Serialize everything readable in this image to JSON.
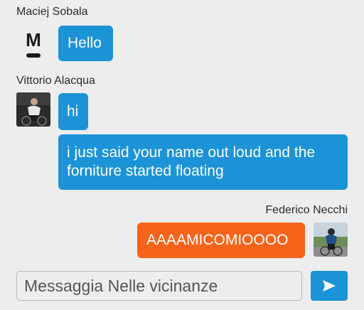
{
  "chat": {
    "messages": [
      {
        "sender": "Maciej Sobala",
        "avatar_letter": "M",
        "text": "Hello"
      },
      {
        "sender": "Vittorio Alacqua",
        "text": "hi"
      },
      {
        "sender": "Vittorio Alacqua",
        "text": "i just said your name out loud and the forniture started floating"
      },
      {
        "sender": "Federico Necchi",
        "text": "AAAAMICOMIOOOO"
      }
    ]
  },
  "composer": {
    "placeholder": "Messaggia Nelle vicinanze",
    "send_icon": "send-icon"
  },
  "colors": {
    "incoming_bubble": "#1b93d6",
    "outgoing_bubble": "#f6641a",
    "background": "#ededed"
  }
}
